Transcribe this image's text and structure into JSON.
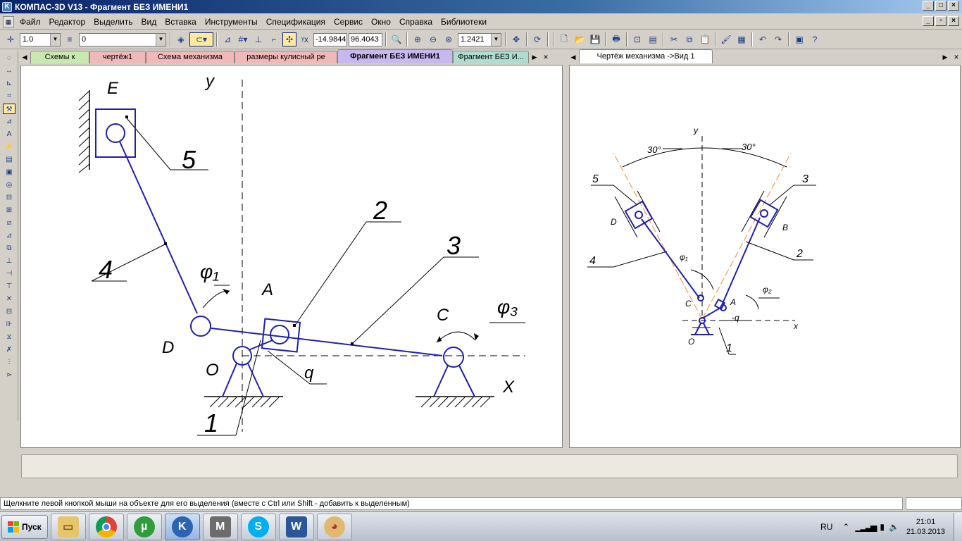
{
  "window": {
    "title": "КОМПАС-3D V13 - Фрагмент БЕЗ ИМЕНИ1"
  },
  "menu": [
    "Файл",
    "Редактор",
    "Выделить",
    "Вид",
    "Вставка",
    "Инструменты",
    "Спецификация",
    "Сервис",
    "Окно",
    "Справка",
    "Библиотеки"
  ],
  "toolbar": {
    "scale_value": "1.0",
    "layer_value": "0",
    "coord_x": "-14.9844",
    "coord_y": "96.4043",
    "zoom_value": "1.2421"
  },
  "tabs_left": [
    "Схемы к",
    "чертёж1",
    "Схема механизма",
    "размеры кулисный ре",
    "Фрагмент БЕЗ ИМЕНИ1",
    "Фрагмент БЕЗ И..."
  ],
  "tab_colors": [
    "#c8e8b0",
    "#f0b8b8",
    "#f0b8b8",
    "#f0b8b8",
    "#c8b8f0",
    "#b0dcd0"
  ],
  "active_tab_index": 4,
  "tabs_right": [
    "Чертёж механизма ->Вид 1"
  ],
  "drawing_left": {
    "labels": {
      "E": "E",
      "y": "y",
      "n5": "5",
      "n2": "2",
      "n3": "3",
      "n4": "4",
      "phi1": "φ₁",
      "A": "A",
      "C": "C",
      "phi3": "φ₃",
      "D": "D",
      "O": "O",
      "q": "q",
      "n1": "1",
      "X": "X"
    }
  },
  "drawing_right": {
    "labels": {
      "y": "y",
      "a30l": "30°",
      "a30r": "30°",
      "n5": "5",
      "n3": "3",
      "D": "D",
      "B": "B",
      "n4": "4",
      "n2": "2",
      "phi1": "φ₁",
      "phi2": "φ₂",
      "C": "C",
      "A": "A",
      "q": "-q",
      "x": "x",
      "O": "O",
      "n1": "1"
    }
  },
  "status": {
    "message": "Щелкните левой кнопкой мыши на объекте для его выделения (вместе с Ctrl или Shift - добавить к выделенным)"
  },
  "taskbar": {
    "start": "Пуск",
    "apps": [
      "explorer",
      "chrome",
      "utorrent",
      "kompas",
      "mathcad",
      "skype",
      "word",
      "paint"
    ],
    "lang": "RU",
    "time": "21:01",
    "date": "21.03.2013"
  }
}
